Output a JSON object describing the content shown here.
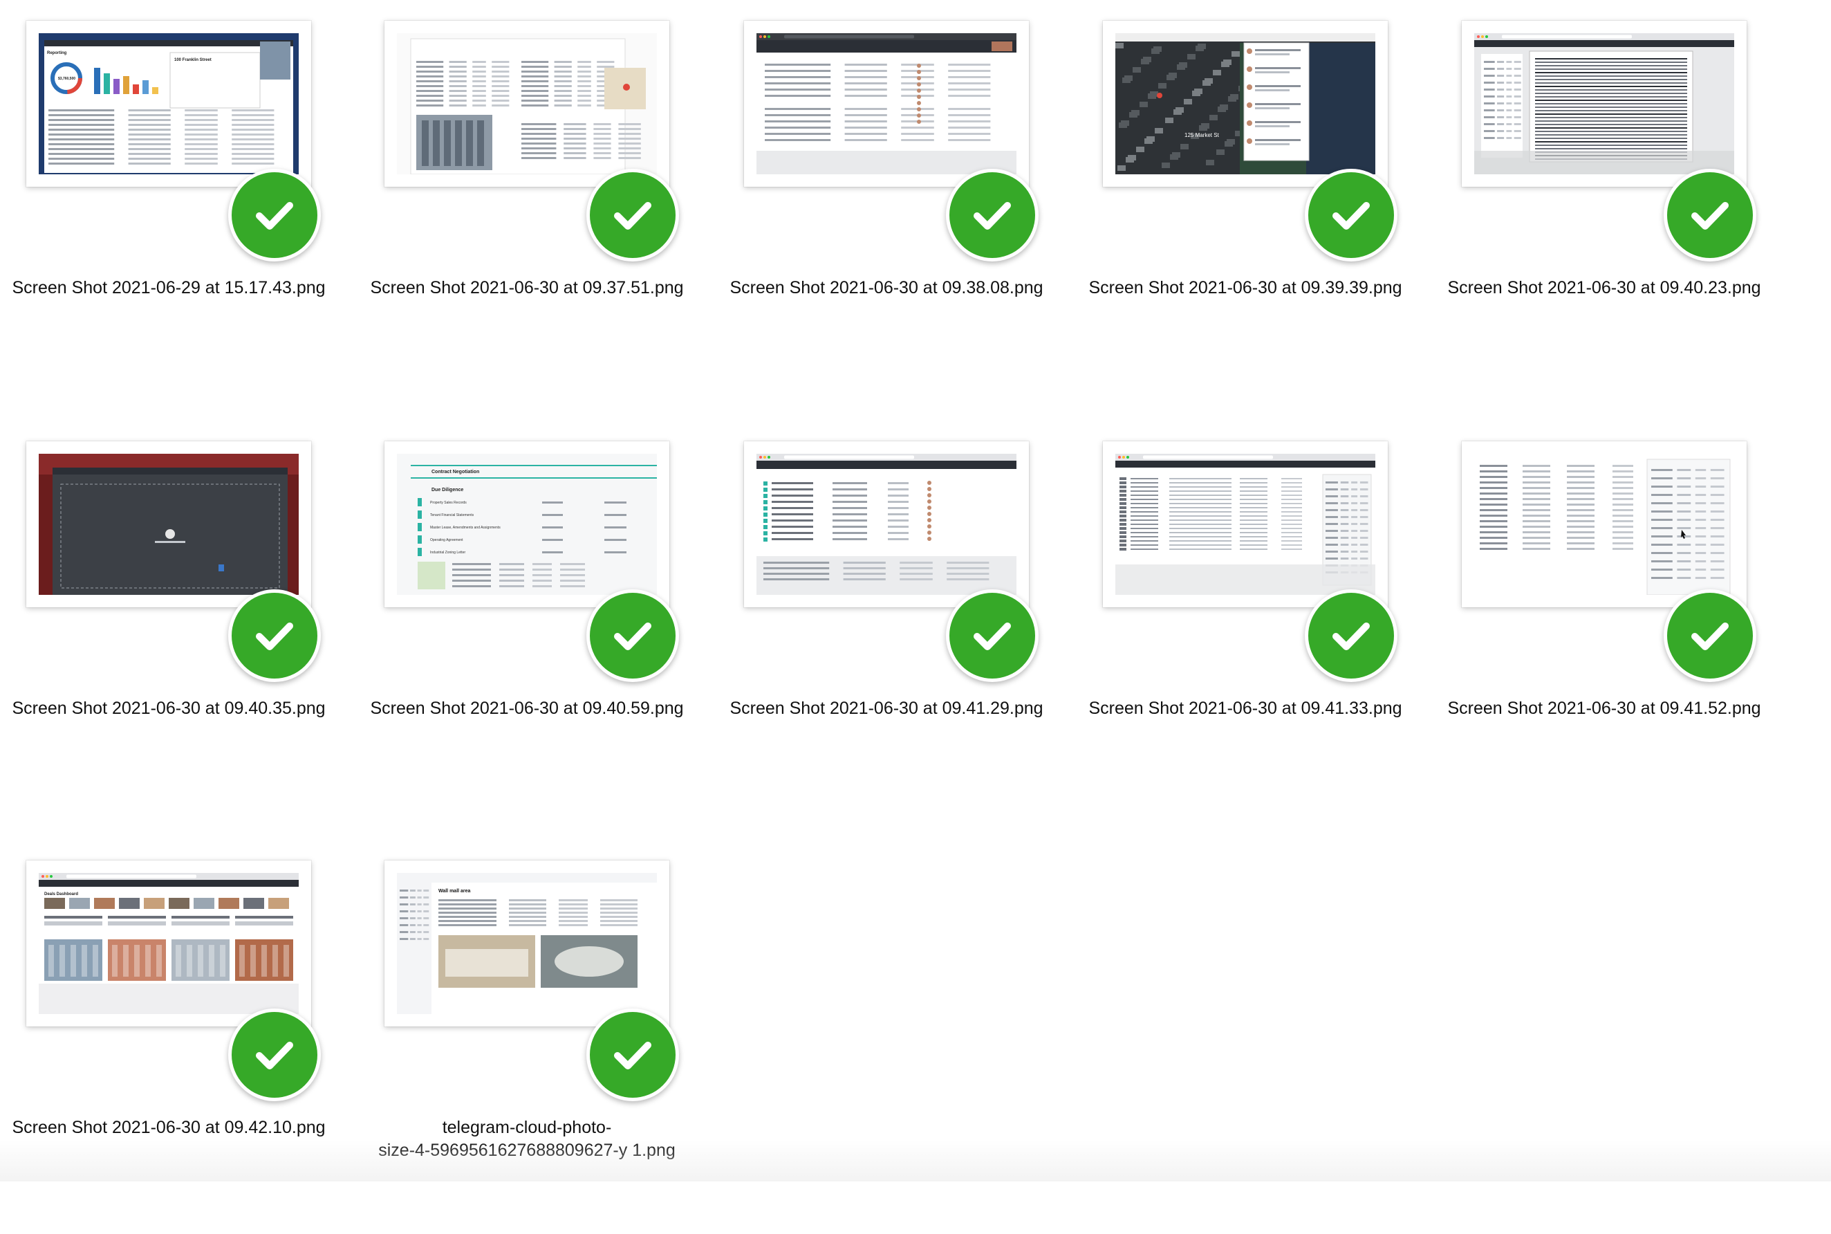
{
  "files": [
    {
      "name": "Screen Shot 2021-06-29 at 15.17.43.png",
      "status": "check-icon"
    },
    {
      "name": "Screen Shot 2021-06-30 at 09.37.51.png",
      "status": "check-icon"
    },
    {
      "name": "Screen Shot 2021-06-30 at 09.38.08.png",
      "status": "check-icon"
    },
    {
      "name": "Screen Shot 2021-06-30 at 09.39.39.png",
      "status": "check-icon"
    },
    {
      "name": "Screen Shot 2021-06-30 at 09.40.23.png",
      "status": "check-icon"
    },
    {
      "name": "Screen Shot 2021-06-30 at 09.40.35.png",
      "status": "check-icon"
    },
    {
      "name": "Screen Shot 2021-06-30 at 09.40.59.png",
      "status": "check-icon"
    },
    {
      "name": "Screen Shot 2021-06-30 at 09.41.29.png",
      "status": "check-icon"
    },
    {
      "name": "Screen Shot 2021-06-30 at 09.41.33.png",
      "status": "check-icon"
    },
    {
      "name": "Screen Shot 2021-06-30 at 09.41.52.png",
      "status": "check-icon"
    },
    {
      "name": "Screen Shot 2021-06-30 at 09.42.10.png",
      "status": "check-icon"
    },
    {
      "name": "telegram-cloud-photo-size-4-5969561627688809627-y 1.png",
      "name_lines": [
        "telegram-cloud-photo-",
        "size-4-5969561627688809627-y 1.png"
      ],
      "status": "check-icon"
    }
  ],
  "thumbnail_text": {
    "reporting_title": "Reporting",
    "property_name": "100 Franklin Street",
    "chart_total": "$3,760,500",
    "map_street": "125 Market St",
    "contract_negotiation": "Contract Negotiation",
    "due_diligence": "Due Diligence",
    "due_diligence_items": [
      "Property Sales Records",
      "Tenant Financial Statements",
      "Master Lease, Amendments and Assignments",
      "Operating Agreement",
      "Industrial Zoning Letter"
    ],
    "hall_title": "Wall mall area",
    "deals_dashboard": "Deals Dashboard"
  },
  "colors": {
    "badge_green": "#36a928",
    "dark_nav": "#2b2f36",
    "teal": "#2bb3a3"
  }
}
